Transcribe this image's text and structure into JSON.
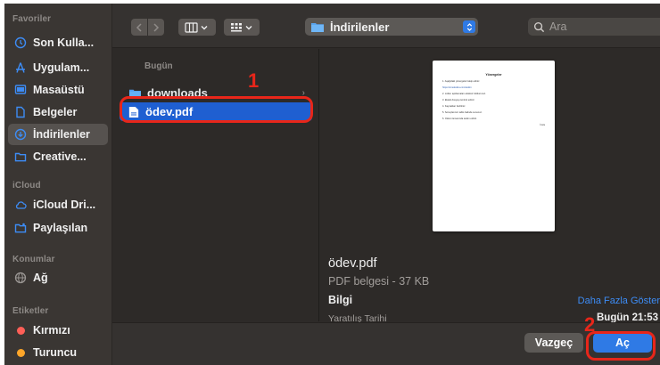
{
  "sidebar": {
    "favorites_title": "Favoriler",
    "favorites": [
      {
        "label": "Son Kulla...",
        "icon": "clock-icon"
      },
      {
        "label": "Uygulam...",
        "icon": "apps-icon"
      },
      {
        "label": "Masaüstü",
        "icon": "desktop-icon"
      },
      {
        "label": "Belgeler",
        "icon": "document-icon"
      },
      {
        "label": "İndirilenler",
        "icon": "download-icon",
        "selected": true
      },
      {
        "label": "Creative...",
        "icon": "folder-icon"
      }
    ],
    "icloud_title": "iCloud",
    "icloud": [
      {
        "label": "iCloud Dri...",
        "icon": "cloud-icon"
      },
      {
        "label": "Paylaşılan",
        "icon": "shared-folder-icon"
      }
    ],
    "locations_title": "Konumlar",
    "locations": [
      {
        "label": "Ağ",
        "icon": "network-icon"
      }
    ],
    "tags_title": "Etiketler",
    "tags": [
      {
        "label": "Kırmızı",
        "color": "#ff5f57"
      },
      {
        "label": "Turuncu",
        "color": "#ffa629"
      }
    ]
  },
  "toolbar": {
    "location": "İndirilenler",
    "search_placeholder": "Ara"
  },
  "column": {
    "header": "Bugün",
    "items": [
      {
        "label": "downloads",
        "icon": "folder-icon"
      },
      {
        "label": "ödev.pdf",
        "icon": "pdf-file-icon",
        "selected": true
      }
    ]
  },
  "preview": {
    "doc_title": "Yönergeler",
    "doc_lines": [
      "1. Aşağıdaki yönergeleri takip ediniz.",
      "https://ornekodev.com/teslim",
      "2. Lütfen açıklamaları eksiksiz doldurunuz.",
      "3. Ekteki dosyayı kontrol ediniz.",
      "4. Kaynakları belirtiniz.",
      "5. Sonuçlarınızı tablo halinde sununuz.",
      "6. Ödevi zamanında teslim ediniz."
    ],
    "doc_sign": "İmza",
    "file_name": "ödev.pdf",
    "kind": "PDF belgesi - 37 KB",
    "info_label": "Bilgi",
    "show_more": "Daha Fazla Göster",
    "created_label": "Yaratılış Tarihi",
    "created_value": "Bugün 21:53"
  },
  "buttons": {
    "cancel": "Vazgeç",
    "open": "Aç"
  },
  "annotations": {
    "step1": "1",
    "step2": "2"
  },
  "colors": {
    "accent": "#2f7ae5",
    "annotation": "#e8261a"
  }
}
